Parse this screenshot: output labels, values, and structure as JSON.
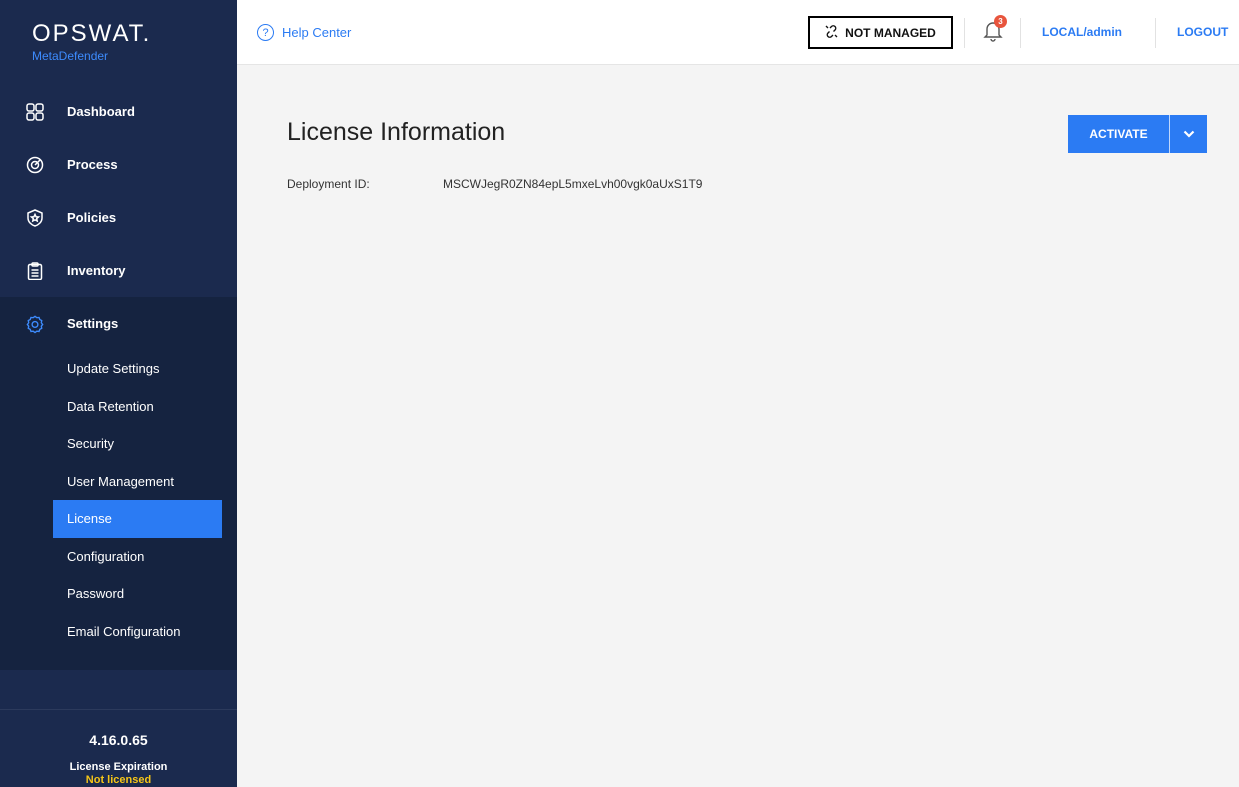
{
  "brand": {
    "logo": "OPSWAT.",
    "product": "MetaDefender"
  },
  "sidebar": {
    "items": [
      {
        "label": "Dashboard",
        "icon": "dashboard-icon"
      },
      {
        "label": "Process",
        "icon": "process-icon"
      },
      {
        "label": "Policies",
        "icon": "policies-icon"
      },
      {
        "label": "Inventory",
        "icon": "inventory-icon"
      },
      {
        "label": "Settings",
        "icon": "gear-icon"
      }
    ],
    "settings_sub": [
      {
        "label": "Update Settings"
      },
      {
        "label": "Data Retention"
      },
      {
        "label": "Security"
      },
      {
        "label": "User Management"
      },
      {
        "label": "License",
        "active": true
      },
      {
        "label": "Configuration"
      },
      {
        "label": "Password"
      },
      {
        "label": "Email Configuration"
      }
    ],
    "footer": {
      "version": "4.16.0.65",
      "expiration_label": "License Expiration",
      "expiration_value": "Not licensed"
    }
  },
  "topbar": {
    "help": "Help Center",
    "not_managed": "NOT MANAGED",
    "notifications_count": "3",
    "user": "LOCAL/admin",
    "logout": "LOGOUT"
  },
  "main": {
    "title": "License Information",
    "deployment_label": "Deployment ID:",
    "deployment_value": "MSCWJegR0ZN84epL5mxeLvh00vgk0aUxS1T9",
    "activate_label": "ACTIVATE"
  },
  "colors": {
    "sidebar": "#1b2a4e",
    "accent": "#2b7bf3",
    "badge": "#e8553d",
    "warning": "#f5c518"
  }
}
